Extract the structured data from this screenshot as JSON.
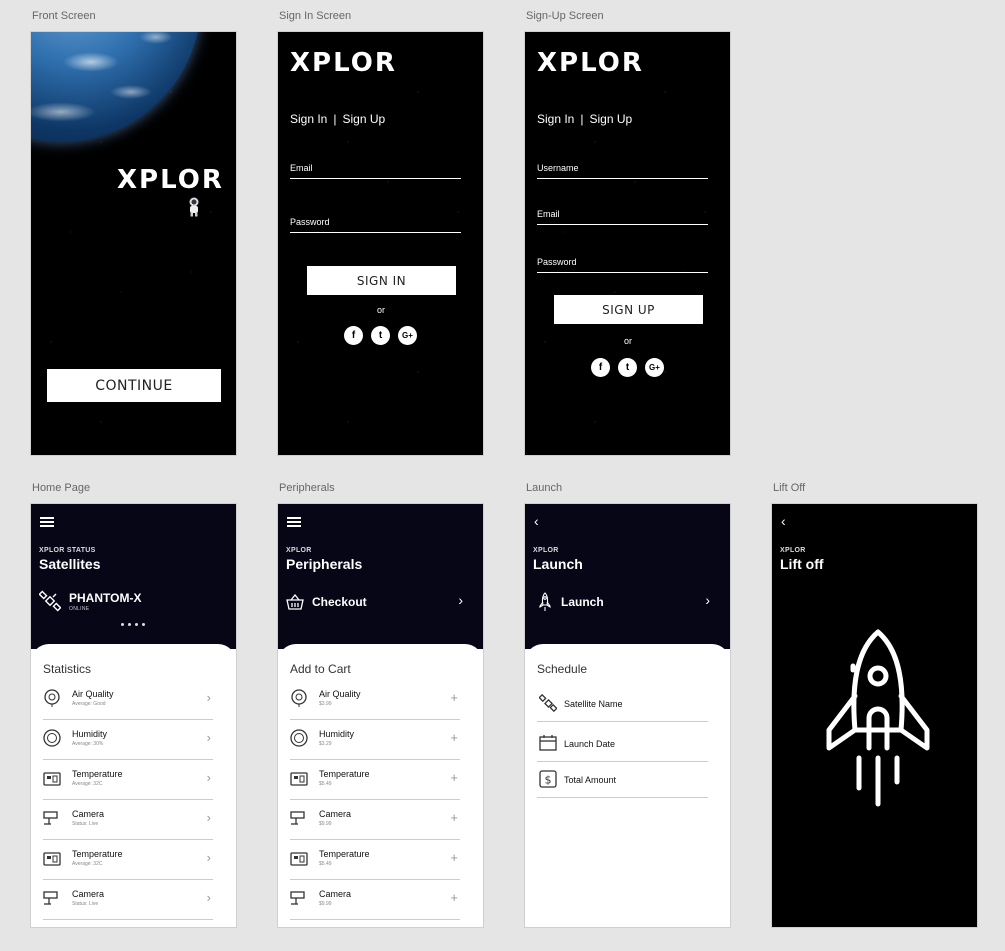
{
  "labels": {
    "front": "Front Screen",
    "signin": "Sign In Screen",
    "signup": "Sign-Up Screen",
    "home": "Home Page",
    "peripherals": "Peripherals",
    "launch": "Launch",
    "liftoff": "Lift Off"
  },
  "brand": {
    "logo": "XPLOR"
  },
  "front": {
    "continue_label": "CONTINUE"
  },
  "signin": {
    "tab_signin": "Sign In",
    "tab_sep": "|",
    "tab_signup": "Sign Up",
    "email_label": "Email",
    "password_label": "Password",
    "button_label": "SIGN IN",
    "or_text": "or"
  },
  "signup": {
    "tab_signin": "Sign In",
    "tab_sep": "|",
    "tab_signup": "Sign Up",
    "username_label": "Username",
    "email_label": "Email",
    "password_label": "Password",
    "button_label": "SIGN UP",
    "or_text": "or"
  },
  "social": {
    "facebook": "f",
    "twitter": "t",
    "google": "G+"
  },
  "home": {
    "eyebrow": "XPLOR STATUS",
    "title": "Satellites",
    "satellite_name": "PHANTOM-X",
    "satellite_status": "ONLINE",
    "card_title": "Statistics",
    "items": [
      {
        "label": "Air Quality",
        "sub": "Average: Good",
        "icon": "air-quality-icon"
      },
      {
        "label": "Humidity",
        "sub": "Average: 30%",
        "icon": "humidity-icon"
      },
      {
        "label": "Temperature",
        "sub": "Average: 32C",
        "icon": "temperature-icon"
      },
      {
        "label": "Camera",
        "sub": "Status: Live",
        "icon": "camera-icon"
      },
      {
        "label": "Temperature",
        "sub": "Average: 32C",
        "icon": "temperature-icon"
      },
      {
        "label": "Camera",
        "sub": "Status: Live",
        "icon": "camera-icon"
      }
    ]
  },
  "peripherals": {
    "eyebrow": "XPLOR",
    "title": "Peripherals",
    "feature": "Checkout",
    "card_title": "Add to Cart",
    "items": [
      {
        "label": "Air Quality",
        "sub": "$3.99"
      },
      {
        "label": "Humidity",
        "sub": "$3.29"
      },
      {
        "label": "Temperature",
        "sub": "$5.49"
      },
      {
        "label": "Camera",
        "sub": "$9.99"
      },
      {
        "label": "Temperature",
        "sub": "$5.49"
      },
      {
        "label": "Camera",
        "sub": "$9.99"
      }
    ]
  },
  "launch": {
    "eyebrow": "XPLOR",
    "title": "Launch",
    "feature": "Launch",
    "card_title": "Schedule",
    "items": [
      {
        "label": "Satellite Name",
        "icon": "satellite-icon"
      },
      {
        "label": "Launch Date",
        "icon": "calendar-icon"
      },
      {
        "label": "Total Amount",
        "icon": "dollar-icon"
      }
    ]
  },
  "liftoff": {
    "eyebrow": "XPLOR",
    "title": "Lift off"
  }
}
